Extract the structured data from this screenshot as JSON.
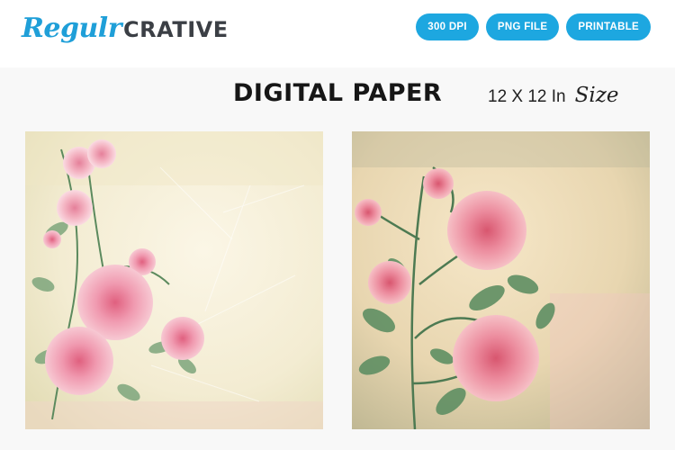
{
  "brand": {
    "script": "Regulr",
    "bold": "CRATIVE"
  },
  "badges": [
    "300 DPI",
    "PNG FILE",
    "PRINTABLE"
  ],
  "title": "DIGITAL PAPER",
  "size": {
    "text": "12 X 12 In",
    "script": "Size"
  },
  "images": [
    {
      "name": "Watercolor roses corner paper"
    },
    {
      "name": "Vintage pink roses paper"
    }
  ],
  "colors": {
    "accent": "#1da7e0",
    "brand_script": "#1f9fd8",
    "brand_text": "#3b3f45"
  }
}
